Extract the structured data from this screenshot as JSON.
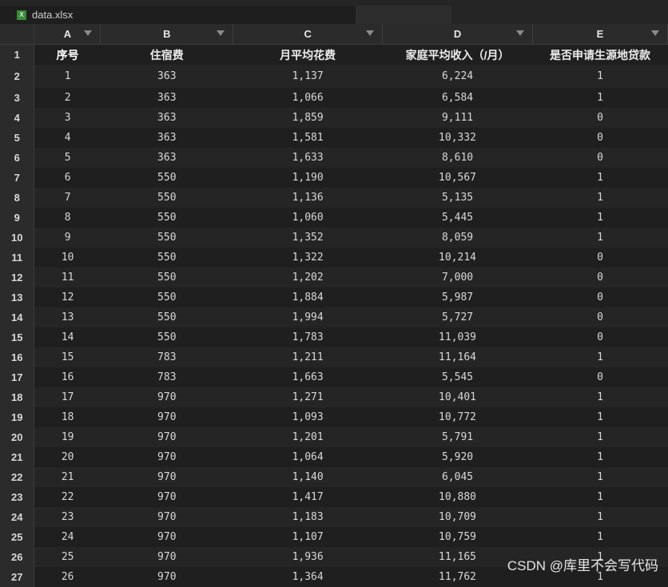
{
  "tab": {
    "filename": "data.xlsx",
    "icon": "excel-file-icon"
  },
  "columns": [
    "A",
    "B",
    "C",
    "D",
    "E"
  ],
  "header": [
    "序号",
    "住宿费",
    "月平均花费",
    "家庭平均收入（/月）",
    "是否申请生源地贷款"
  ],
  "rows": [
    [
      "1",
      "363",
      "1,137",
      "6,224",
      "1"
    ],
    [
      "2",
      "363",
      "1,066",
      "6,584",
      "1"
    ],
    [
      "3",
      "363",
      "1,859",
      "9,111",
      "0"
    ],
    [
      "4",
      "363",
      "1,581",
      "10,332",
      "0"
    ],
    [
      "5",
      "363",
      "1,633",
      "8,610",
      "0"
    ],
    [
      "6",
      "550",
      "1,190",
      "10,567",
      "1"
    ],
    [
      "7",
      "550",
      "1,136",
      "5,135",
      "1"
    ],
    [
      "8",
      "550",
      "1,060",
      "5,445",
      "1"
    ],
    [
      "9",
      "550",
      "1,352",
      "8,059",
      "1"
    ],
    [
      "10",
      "550",
      "1,322",
      "10,214",
      "0"
    ],
    [
      "11",
      "550",
      "1,202",
      "7,000",
      "0"
    ],
    [
      "12",
      "550",
      "1,884",
      "5,987",
      "0"
    ],
    [
      "13",
      "550",
      "1,994",
      "5,727",
      "0"
    ],
    [
      "14",
      "550",
      "1,783",
      "11,039",
      "0"
    ],
    [
      "15",
      "783",
      "1,211",
      "11,164",
      "1"
    ],
    [
      "16",
      "783",
      "1,663",
      "5,545",
      "0"
    ],
    [
      "17",
      "970",
      "1,271",
      "10,401",
      "1"
    ],
    [
      "18",
      "970",
      "1,093",
      "10,772",
      "1"
    ],
    [
      "19",
      "970",
      "1,201",
      "5,791",
      "1"
    ],
    [
      "20",
      "970",
      "1,064",
      "5,920",
      "1"
    ],
    [
      "21",
      "970",
      "1,140",
      "6,045",
      "1"
    ],
    [
      "22",
      "970",
      "1,417",
      "10,880",
      "1"
    ],
    [
      "23",
      "970",
      "1,183",
      "10,709",
      "1"
    ],
    [
      "24",
      "970",
      "1,107",
      "10,759",
      "1"
    ],
    [
      "25",
      "970",
      "1,936",
      "11,165",
      "1"
    ],
    [
      "26",
      "970",
      "1,364",
      "11,762",
      "1"
    ]
  ],
  "row_numbers": [
    "1",
    "2",
    "3",
    "4",
    "5",
    "6",
    "7",
    "8",
    "9",
    "10",
    "11",
    "12",
    "13",
    "14",
    "15",
    "16",
    "17",
    "18",
    "19",
    "20",
    "21",
    "22",
    "23",
    "24",
    "25",
    "26",
    "27"
  ],
  "watermark": "CSDN @库里不会写代码",
  "colors": {
    "selected_cell": "#1d4a73",
    "background": "#1e1e1e",
    "header_bg": "#2b2b2b"
  }
}
